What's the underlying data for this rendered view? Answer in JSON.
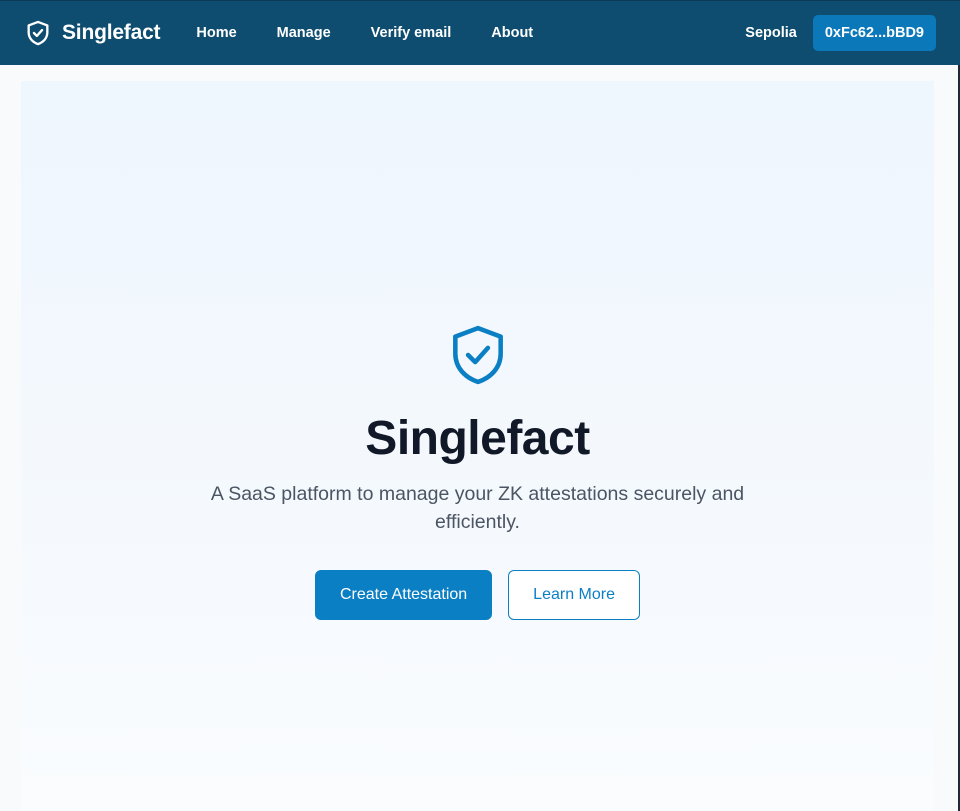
{
  "navbar": {
    "brand_name": "Singlefact",
    "brand_icon": "shield-check-icon",
    "links": [
      {
        "label": "Home"
      },
      {
        "label": "Manage"
      },
      {
        "label": "Verify email"
      },
      {
        "label": "About"
      }
    ],
    "network": "Sepolia",
    "wallet_address": "0xFc62...bBD9"
  },
  "hero": {
    "icon": "shield-check-icon",
    "title": "Singlefact",
    "subtitle": "A SaaS platform to manage your ZK attestations securely and efficiently.",
    "primary_button": "Create Attestation",
    "secondary_button": "Learn More"
  },
  "colors": {
    "navbar_bg": "#0e4d6f",
    "accent": "#0b7fc4",
    "title_text": "#111827",
    "body_text": "#4b5563"
  }
}
